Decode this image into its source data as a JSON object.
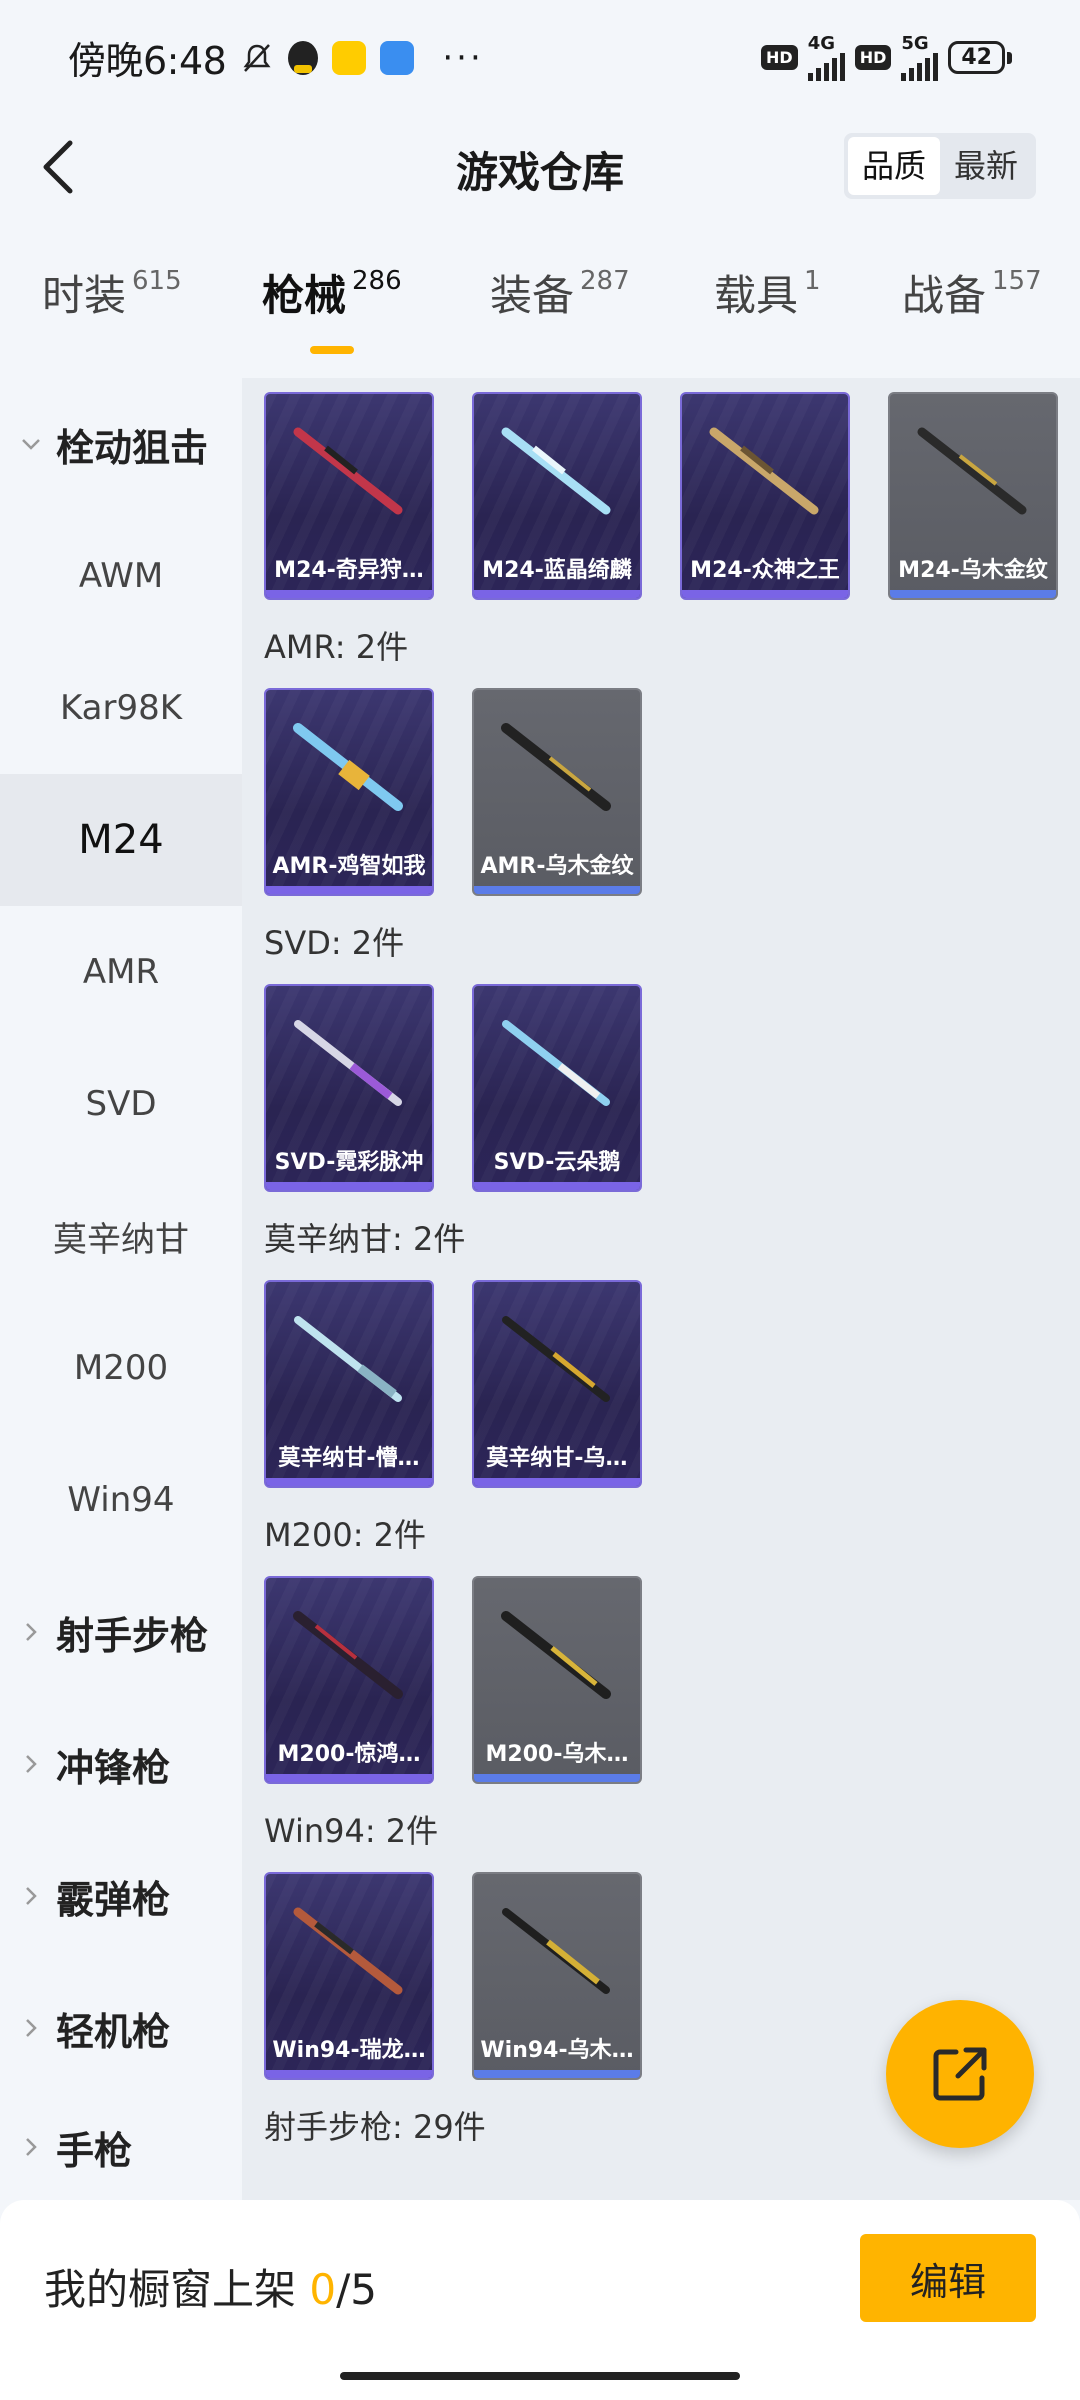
{
  "status_bar": {
    "time": "傍晚6:48",
    "more": "···",
    "hd1": "HD",
    "net1": "4G",
    "hd2": "HD",
    "net2": "5G",
    "battery": "42"
  },
  "header": {
    "title": "游戏仓库",
    "sort": {
      "quality": "品质",
      "latest": "最新"
    }
  },
  "tabs": [
    {
      "label": "时装",
      "count": "615"
    },
    {
      "label": "枪械",
      "count": "286"
    },
    {
      "label": "装备",
      "count": "287"
    },
    {
      "label": "载具",
      "count": "1"
    },
    {
      "label": "战备",
      "count": "157"
    }
  ],
  "sidebar": {
    "items": [
      "栓动狙击",
      "AWM",
      "Kar98K",
      "M24",
      "AMR",
      "SVD",
      "莫辛纳甘",
      "M200",
      "Win94",
      "射手步枪",
      "冲锋枪",
      "霰弹枪",
      "轻机枪",
      "手枪"
    ]
  },
  "content": {
    "row_m24": [
      "M24-奇异狩…",
      "M24-蓝晶绮麟",
      "M24-众神之王",
      "M24-乌木金纹"
    ],
    "amr_title": "AMR: 2件",
    "row_amr": [
      "AMR-鸡智如我",
      "AMR-乌木金纹"
    ],
    "svd_title": "SVD: 2件",
    "row_svd": [
      "SVD-霓彩脉冲",
      "SVD-云朵鹅"
    ],
    "mosin_title": "莫辛纳甘: 2件",
    "row_mosin": [
      "莫辛纳甘-懵…",
      "莫辛纳甘-乌…"
    ],
    "m200_title": "M200: 2件",
    "row_m200": [
      "M200-惊鸿…",
      "M200-乌木…"
    ],
    "win94_title": "Win94: 2件",
    "row_win94": [
      "Win94-瑞龙…",
      "Win94-乌木…"
    ],
    "dmr_title": "射手步枪: 29件"
  },
  "bottom_bar": {
    "label": "我的橱窗上架",
    "count_current": "0",
    "count_total": "/5",
    "edit": "编辑"
  },
  "colors": {
    "accent": "#ffb400",
    "card_purple": "#2a2452",
    "card_gray": "#5a5c63"
  }
}
